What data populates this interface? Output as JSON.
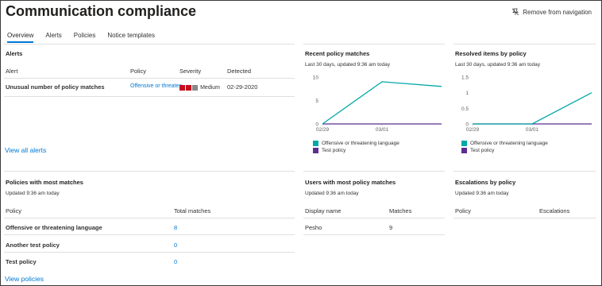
{
  "header": {
    "title": "Communication compliance",
    "remove_nav": "Remove from navigation"
  },
  "tabs": [
    {
      "label": "Overview",
      "active": true
    },
    {
      "label": "Alerts"
    },
    {
      "label": "Policies"
    },
    {
      "label": "Notice templates"
    }
  ],
  "alerts": {
    "title": "Alerts",
    "columns": [
      "Alert",
      "Policy",
      "Severity",
      "Detected"
    ],
    "rows": [
      {
        "alert": "Unusual number of policy matches",
        "policy": "Offensive or threaten...",
        "severity": "Medium",
        "detected": "02-29-2020"
      }
    ],
    "severity_colors": [
      "#c50f1f",
      "#c50f1f",
      "#8a8886"
    ],
    "view_all": "View all alerts"
  },
  "recent_matches": {
    "title": "Recent policy matches",
    "subtitle": "Last 30 days, updated 9:36 am today"
  },
  "resolved_items": {
    "title": "Resolved items by policy",
    "subtitle": "Last 30 days, updated 9:36 am today"
  },
  "chart_data": [
    {
      "type": "line",
      "title": "Recent policy matches",
      "x": [
        "02/29",
        "03/01",
        "03/02"
      ],
      "x_tick_labels": [
        "02/29",
        "03/01"
      ],
      "yticks": [
        "0",
        "5",
        "10"
      ],
      "ylim": [
        0,
        10
      ],
      "series": [
        {
          "name": "Offensive or threatening language",
          "values": [
            0,
            9,
            8
          ],
          "color": "#00a8a8"
        },
        {
          "name": "Test policy",
          "values": [
            0,
            0,
            0
          ],
          "color": "#5c2e91"
        }
      ]
    },
    {
      "type": "line",
      "title": "Resolved items by policy",
      "x": [
        "02/29",
        "03/01",
        "03/02"
      ],
      "x_tick_labels": [
        "02/29",
        "03/01"
      ],
      "yticks": [
        "0",
        "0.5",
        "1",
        "1.5"
      ],
      "ylim": [
        0,
        1.5
      ],
      "series": [
        {
          "name": "Offensive or threatening language",
          "values": [
            0,
            0,
            1
          ],
          "color": "#00a8a8"
        },
        {
          "name": "Test policy",
          "values": [
            0,
            0,
            0
          ],
          "color": "#5c2e91"
        }
      ]
    }
  ],
  "policies_most": {
    "title": "Policies with most matches",
    "subtitle": "Updated 9:36 am today",
    "columns": [
      "Policy",
      "Total matches"
    ],
    "rows": [
      {
        "policy": "Offensive or threatening language",
        "matches": "8"
      },
      {
        "policy": "Another test policy",
        "matches": "0"
      },
      {
        "policy": "Test policy",
        "matches": "0"
      }
    ],
    "view": "View policies"
  },
  "users_most": {
    "title": "Users with most policy matches",
    "subtitle": "Updated 9:36 am today",
    "columns": [
      "Display name",
      "Matches"
    ],
    "rows": [
      {
        "name": "Pesho",
        "matches": "9"
      }
    ]
  },
  "escalations": {
    "title": "Escalations by policy",
    "subtitle": "Updated 9:36 am today",
    "columns": [
      "Policy",
      "Escalations"
    ]
  }
}
